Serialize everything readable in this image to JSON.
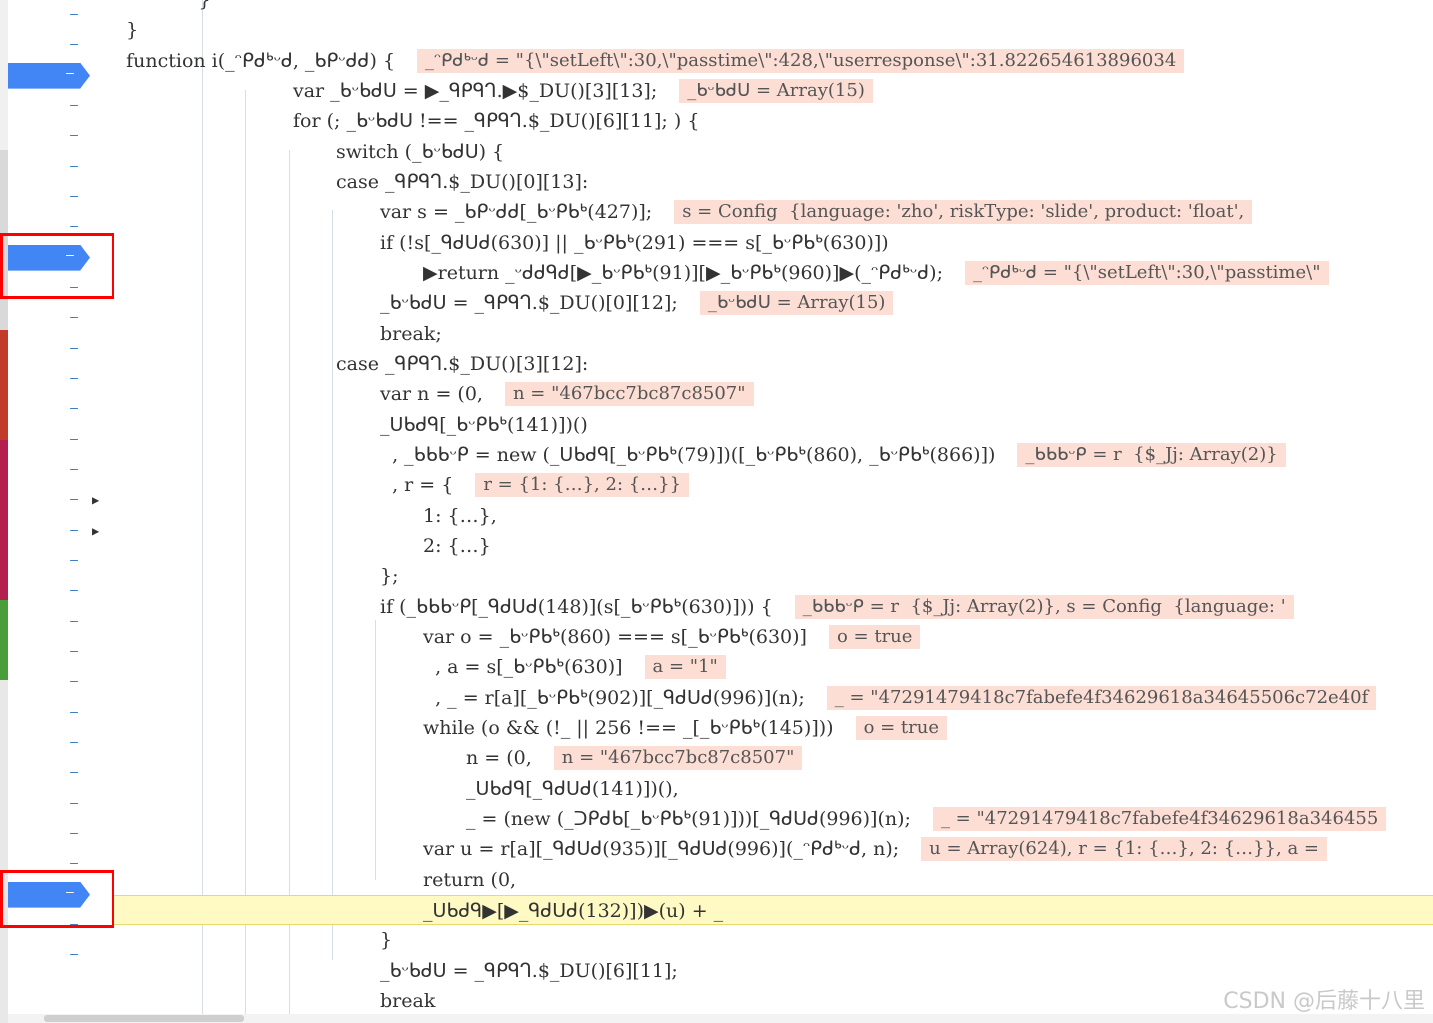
{
  "gutter": {
    "line_marker": "–",
    "rows": [
      {
        "type": "line"
      },
      {
        "type": "line"
      },
      {
        "type": "breakpoint"
      },
      {
        "type": "line"
      },
      {
        "type": "line"
      },
      {
        "type": "line"
      },
      {
        "type": "line"
      },
      {
        "type": "line"
      },
      {
        "type": "breakpoint",
        "highlight_box": true
      },
      {
        "type": "line"
      },
      {
        "type": "line"
      },
      {
        "type": "line"
      },
      {
        "type": "line"
      },
      {
        "type": "line"
      },
      {
        "type": "line"
      },
      {
        "type": "line"
      },
      {
        "type": "line",
        "expand": true
      },
      {
        "type": "line",
        "expand": true
      },
      {
        "type": "line"
      },
      {
        "type": "line"
      },
      {
        "type": "line"
      },
      {
        "type": "line"
      },
      {
        "type": "line"
      },
      {
        "type": "line"
      },
      {
        "type": "line"
      },
      {
        "type": "line"
      },
      {
        "type": "line"
      },
      {
        "type": "line"
      },
      {
        "type": "line"
      },
      {
        "type": "breakpoint",
        "highlight_box": true
      },
      {
        "type": "line"
      },
      {
        "type": "line"
      }
    ]
  },
  "code_lines": [
    {
      "indent": 0,
      "text": "              }",
      "eval": null
    },
    {
      "indent": 0,
      "text": "  }",
      "eval": null
    },
    {
      "indent": 0,
      "text": "  function i(_ᵔᑭᑯᒃᵕᑯ, _ᑲᑭᵕᑯᑯ) {",
      "eval": "_ᵔᑭᑯᒃᵕᑯ = \"{\\\"setLeft\\\":30,\\\"passtime\\\":428,\\\"userresponse\\\":31.822654613896034"
    },
    {
      "indent": 1,
      "text": "var _ᑲᵕᑲᑯᑌ = ▶_ᑫᑭᑫᒉ.▶$_DU()[3][13];",
      "eval": "_ᑲᵕᑲᑯᑌ = Array(15)"
    },
    {
      "indent": 1,
      "text": "for (; _ᑲᵕᑲᑯᑌ !== _ᑫᑭᑫᒉ.$_DU()[6][11]; ) {",
      "eval": null
    },
    {
      "indent": 2,
      "text": "switch (_ᑲᵕᑲᑯᑌ) {",
      "eval": null
    },
    {
      "indent": 2,
      "text": "case _ᑫᑭᑫᒉ.$_DU()[0][13]:",
      "eval": null
    },
    {
      "indent": 3,
      "text": "var s = _ᑲᑭᵕᑯᑯ[_ᑲᵕᑭᑲᒃ(427)];",
      "eval": "s = Config  {language: 'zho', riskType: 'slide', product: 'float',"
    },
    {
      "indent": 3,
      "text": "if (!s[_ᑫᑯᑌᑯ(630)] || _ᑲᵕᑭᑲᒃ(291) === s[_ᑲᵕᑭᑲᒃ(630)])",
      "eval": null
    },
    {
      "indent": 4,
      "text": "▶return _ᵕᑯᑯᑫᑯ[▶_ᑲᵕᑭᑲᒃ(91)][▶_ᑲᵕᑭᑲᒃ(960)]▶(_ᵔᑭᑯᒃᵕᑯ);",
      "eval": "_ᵔᑭᑯᒃᵕᑯ = \"{\\\"setLeft\\\":30,\\\"passtime\\\""
    },
    {
      "indent": 3,
      "text": "_ᑲᵕᑲᑯᑌ = _ᑫᑭᑫᒉ.$_DU()[0][12];",
      "eval": "_ᑲᵕᑲᑯᑌ = Array(15)"
    },
    {
      "indent": 3,
      "text": "break;",
      "eval": null
    },
    {
      "indent": 2,
      "text": "case _ᑫᑭᑫᒉ.$_DU()[3][12]:",
      "eval": null
    },
    {
      "indent": 3,
      "text": "var n = (0,",
      "eval": "n = \"467bcc7bc87c8507\""
    },
    {
      "indent": 3,
      "text": "_ᑌᑲᑯᑫ[_ᑲᵕᑭᑲᒃ(141)])()",
      "eval": null
    },
    {
      "indent": 3,
      "text": "  , _ᑲᑲᑲᵕᑭ = new (_ᑌᑲᑯᑫ[_ᑲᵕᑭᑲᒃ(79)])([_ᑲᵕᑭᑲᒃ(860), _ᑲᵕᑭᑲᒃ(866)])",
      "eval": "_ᑲᑲᑲᵕᑭ = r  {$_Jj: Array(2)}"
    },
    {
      "indent": 3,
      "text": "  , r = {",
      "eval": "r = {1: {…}, 2: {…}}"
    },
    {
      "indent": 4,
      "text": "1: {…},",
      "eval": null
    },
    {
      "indent": 4,
      "text": "2: {…}",
      "eval": null
    },
    {
      "indent": 3,
      "text": "};",
      "eval": null
    },
    {
      "indent": 3,
      "text": "if (_ᑲᑲᑲᵕᑭ[_ᑫᑯᑌᑯ(148)](s[_ᑲᵕᑭᑲᒃ(630)])) {",
      "eval": "_ᑲᑲᑲᵕᑭ = r  {$_Jj: Array(2)}, s = Config  {language: '"
    },
    {
      "indent": 4,
      "text": "var o = _ᑲᵕᑭᑲᒃ(860) === s[_ᑲᵕᑭᑲᒃ(630)]",
      "eval": "o = true"
    },
    {
      "indent": 4,
      "text": "  , a = s[_ᑲᵕᑭᑲᒃ(630)]",
      "eval": "a = \"1\""
    },
    {
      "indent": 4,
      "text": "  , _ = r[a][_ᑲᵕᑭᑲᒃ(902)][_ᑫᑯᑌᑯ(996)](n);",
      "eval": "_ = \"47291479418c7fabefe4f34629618a34645506c72e40f"
    },
    {
      "indent": 4,
      "text": "while (o && (!_ || 256 !== _[_ᑲᵕᑭᑲᒃ(145)]))",
      "eval": "o = true"
    },
    {
      "indent": 5,
      "text": "n = (0,",
      "eval": "n = \"467bcc7bc87c8507\""
    },
    {
      "indent": 5,
      "text": "_ᑌᑲᑯᑫ[_ᑫᑯᑌᑯ(141)])(),",
      "eval": null
    },
    {
      "indent": 5,
      "text": "_ = (new (_ᑐᑭᑯᑲ[_ᑲᵕᑭᑲᒃ(91)]))[_ᑫᑯᑌᑯ(996)](n);",
      "eval": "_ = \"47291479418c7fabefe4f34629618a346455"
    },
    {
      "indent": 4,
      "text": "var u = r[a][_ᑫᑯᑌᑯ(935)][_ᑫᑯᑌᑯ(996)](_ᵔᑭᑯᒃᵕᑯ, n);",
      "eval": "u = Array(624), r = {1: {…}, 2: {…}}, a ="
    },
    {
      "indent": 4,
      "text": "return (0,",
      "eval": null
    },
    {
      "indent": 4,
      "text": "_ᑌᑲᑯᑫ▶[▶_ᑫᑯᑌᑯ(132)])▶(u) + _",
      "eval": null
    },
    {
      "indent": 3,
      "text": "}",
      "eval": null
    },
    {
      "indent": 3,
      "text": "_ᑲᵕᑲᑯᑌ = _ᑫᑭᑫᒉ.$_DU()[6][11];",
      "eval": null
    },
    {
      "indent": 3,
      "text": "break",
      "eval": null
    }
  ],
  "watermark": "CSDN @后藤十八里"
}
